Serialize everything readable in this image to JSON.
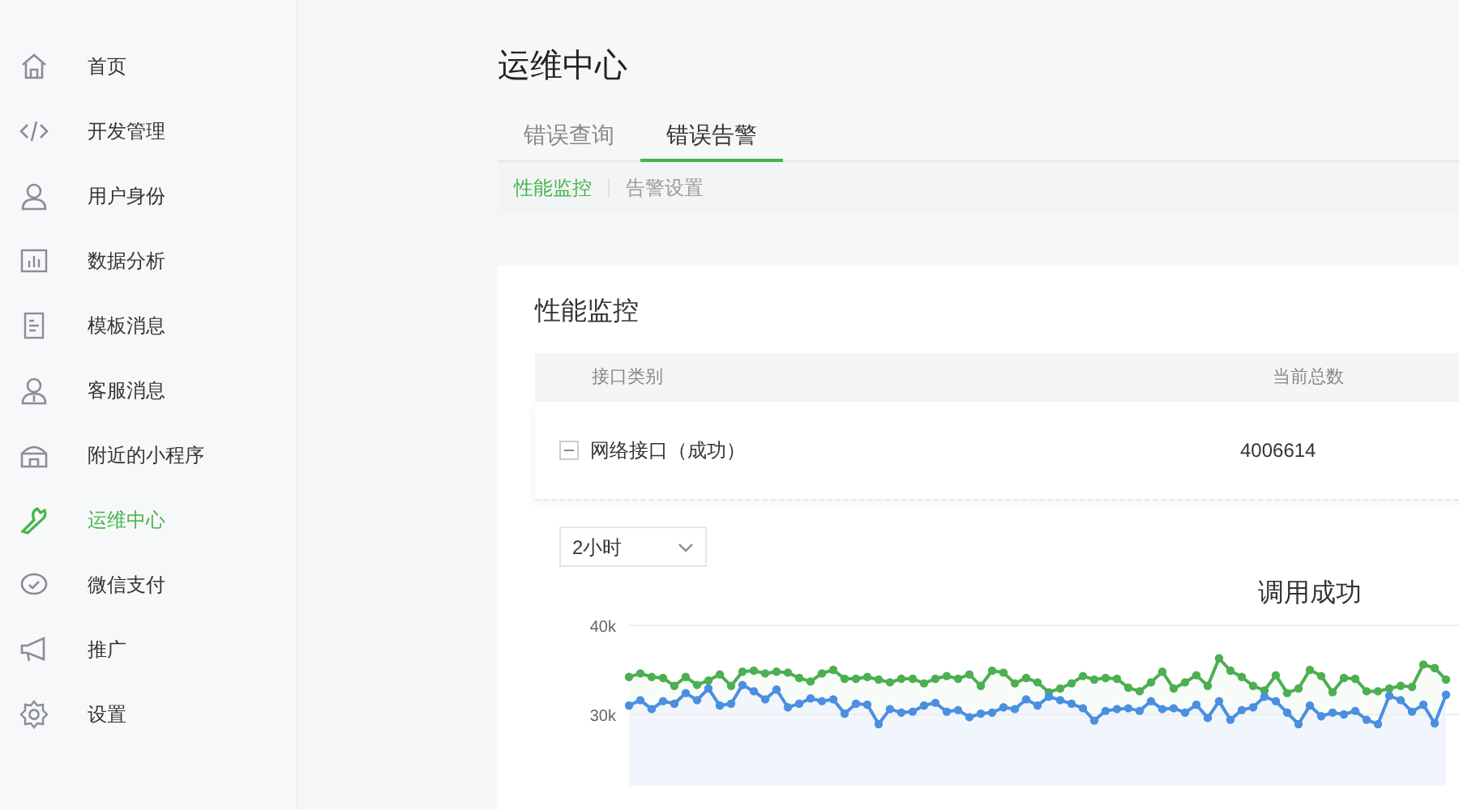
{
  "sidebar": {
    "items": [
      {
        "label": "首页",
        "selected": false
      },
      {
        "label": "开发管理",
        "selected": false
      },
      {
        "label": "用户身份",
        "selected": false
      },
      {
        "label": "数据分析",
        "selected": false
      },
      {
        "label": "模板消息",
        "selected": false
      },
      {
        "label": "客服消息",
        "selected": false
      },
      {
        "label": "附近的小程序",
        "selected": false
      },
      {
        "label": "运维中心",
        "selected": true
      },
      {
        "label": "微信支付",
        "selected": false
      },
      {
        "label": "推广",
        "selected": false
      },
      {
        "label": "设置",
        "selected": false
      }
    ]
  },
  "page_title": "运维中心",
  "tabs": [
    {
      "label": "错误查询",
      "selected": false
    },
    {
      "label": "错误告警",
      "selected": true
    }
  ],
  "subtabs": [
    {
      "label": "性能监控",
      "selected": true
    },
    {
      "label": "告警设置",
      "selected": false
    }
  ],
  "card": {
    "title": "性能监控",
    "table": {
      "columns": [
        "接口类别",
        "当前总数"
      ],
      "rows": [
        {
          "expanded": true,
          "cells": [
            "网络接口（成功）",
            "4006614"
          ]
        }
      ]
    },
    "range_select": {
      "value": "2小时"
    },
    "chart_data": {
      "type": "area",
      "title": "调用成功",
      "ylim": [
        22000,
        40000
      ],
      "yticks": [
        {
          "value": 30000,
          "label": "30k"
        },
        {
          "value": 40000,
          "label": "40k"
        }
      ],
      "series": [
        {
          "color": "#4caf50",
          "marker": "circle",
          "values": [
            34200,
            34600,
            34200,
            34100,
            33200,
            34200,
            33300,
            33800,
            34500,
            33200,
            34800,
            34900,
            34600,
            34800,
            34700,
            34100,
            33700,
            34600,
            35000,
            34000,
            34000,
            34200,
            33900,
            33600,
            34000,
            34000,
            33500,
            34000,
            34300,
            34000,
            34500,
            33200,
            34900,
            34700,
            33500,
            34100,
            33600,
            32500,
            32900,
            33500,
            34300,
            33900,
            34100,
            34000,
            33000,
            32600,
            33600,
            34800,
            32900,
            33600,
            34400,
            33200,
            36300,
            34900,
            34200,
            33200,
            32700,
            34400,
            32400,
            32900,
            35000,
            34300,
            32500,
            34100,
            34000,
            32600,
            32600,
            32900,
            33200,
            33100,
            35600,
            35200,
            33900
          ]
        },
        {
          "color": "#4a8fe0",
          "marker": "circle",
          "values": [
            31000,
            31600,
            30600,
            31500,
            31200,
            32400,
            31600,
            32900,
            31000,
            31200,
            33300,
            32600,
            31700,
            32800,
            30800,
            31200,
            31800,
            31500,
            31700,
            30100,
            31200,
            31100,
            28900,
            30600,
            30200,
            30300,
            31000,
            31300,
            30300,
            30500,
            29700,
            30100,
            30200,
            30800,
            30600,
            31700,
            31000,
            32000,
            31600,
            31200,
            30700,
            29300,
            30400,
            30600,
            30700,
            30400,
            31500,
            30600,
            30700,
            30200,
            31100,
            29600,
            31500,
            29400,
            30500,
            30800,
            32000,
            31500,
            30200,
            28900,
            31000,
            29800,
            30200,
            30000,
            30400,
            29400,
            28900,
            32100,
            31600,
            30300,
            31100,
            29000,
            32200
          ]
        }
      ]
    }
  }
}
